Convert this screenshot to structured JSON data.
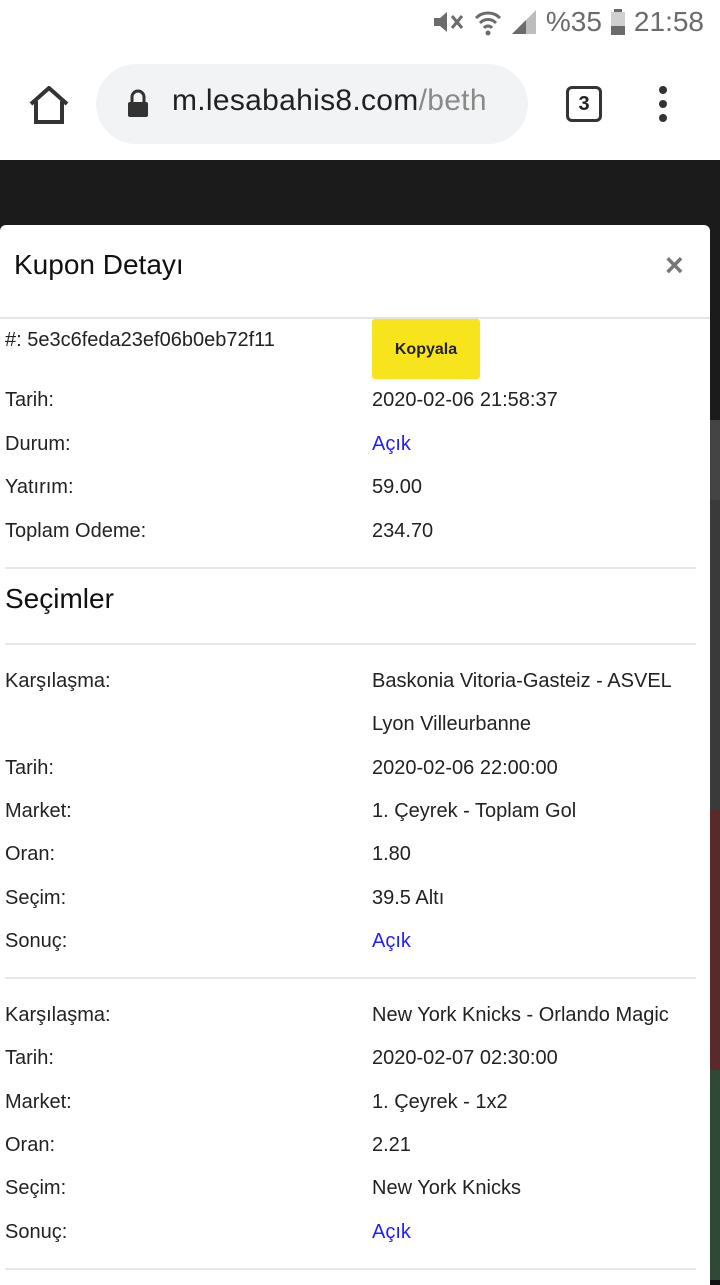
{
  "status_bar": {
    "battery": "%35",
    "time": "21:58"
  },
  "browser": {
    "url_host": "m.lesabahis8.com",
    "url_path": "/beth",
    "tab_count": "3"
  },
  "modal": {
    "title": "Kupon Detayı",
    "close": "×",
    "coupon_id": "#: 5e3c6feda23ef06b0eb72f11",
    "copy_label": "Kopyala",
    "summary": [
      {
        "label": "Tarih:",
        "value": "2020-02-06 21:58:37"
      },
      {
        "label": "Durum:",
        "value": "Açık"
      },
      {
        "label": "Yatırım:",
        "value": "59.00"
      },
      {
        "label": "Toplam Odeme:",
        "value": "234.70"
      }
    ],
    "selections_title": "Seçimler",
    "selections": [
      {
        "match_label": "Karşılaşma:",
        "match_line1": "Baskonia Vitoria-Gasteiz - ASVEL",
        "match_line2": "Lyon Villeurbanne",
        "rows": [
          {
            "label": "Tarih:",
            "value": "2020-02-06 22:00:00"
          },
          {
            "label": "Market:",
            "value": "1. Çeyrek - Toplam Gol"
          },
          {
            "label": "Oran:",
            "value": "1.80"
          },
          {
            "label": "Seçim:",
            "value": "39.5 Altı"
          },
          {
            "label": "Sonuç:",
            "value": "Açık"
          }
        ]
      },
      {
        "match_label": "Karşılaşma:",
        "match_line1": "New York Knicks - Orlando Magic",
        "rows": [
          {
            "label": "Tarih:",
            "value": "2020-02-07 02:30:00"
          },
          {
            "label": "Market:",
            "value": "1. Çeyrek - 1x2"
          },
          {
            "label": "Oran:",
            "value": "2.21"
          },
          {
            "label": "Seçim:",
            "value": "New York Knicks"
          },
          {
            "label": "Sonuç:",
            "value": "Açık"
          }
        ]
      }
    ]
  },
  "colors": {
    "copy_button": "#f7e41d",
    "link": "#1f1fff",
    "page_bg": "#1b1b1b"
  }
}
